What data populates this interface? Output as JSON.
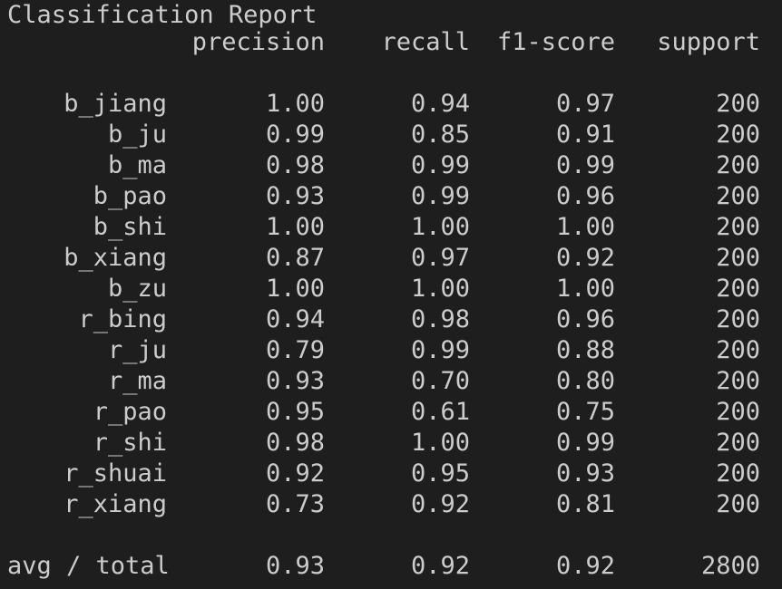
{
  "report": {
    "title": "Classification Report",
    "headers": {
      "precision": "precision",
      "recall": "recall",
      "f1": "f1-score",
      "support": "support"
    },
    "rows": [
      {
        "label": "b_jiang",
        "precision": "1.00",
        "recall": "0.94",
        "f1": "0.97",
        "support": "200"
      },
      {
        "label": "b_ju",
        "precision": "0.99",
        "recall": "0.85",
        "f1": "0.91",
        "support": "200"
      },
      {
        "label": "b_ma",
        "precision": "0.98",
        "recall": "0.99",
        "f1": "0.99",
        "support": "200"
      },
      {
        "label": "b_pao",
        "precision": "0.93",
        "recall": "0.99",
        "f1": "0.96",
        "support": "200"
      },
      {
        "label": "b_shi",
        "precision": "1.00",
        "recall": "1.00",
        "f1": "1.00",
        "support": "200"
      },
      {
        "label": "b_xiang",
        "precision": "0.87",
        "recall": "0.97",
        "f1": "0.92",
        "support": "200"
      },
      {
        "label": "b_zu",
        "precision": "1.00",
        "recall": "1.00",
        "f1": "1.00",
        "support": "200"
      },
      {
        "label": "r_bing",
        "precision": "0.94",
        "recall": "0.98",
        "f1": "0.96",
        "support": "200"
      },
      {
        "label": "r_ju",
        "precision": "0.79",
        "recall": "0.99",
        "f1": "0.88",
        "support": "200"
      },
      {
        "label": "r_ma",
        "precision": "0.93",
        "recall": "0.70",
        "f1": "0.80",
        "support": "200"
      },
      {
        "label": "r_pao",
        "precision": "0.95",
        "recall": "0.61",
        "f1": "0.75",
        "support": "200"
      },
      {
        "label": "r_shi",
        "precision": "0.98",
        "recall": "1.00",
        "f1": "0.99",
        "support": "200"
      },
      {
        "label": "r_shuai",
        "precision": "0.92",
        "recall": "0.95",
        "f1": "0.93",
        "support": "200"
      },
      {
        "label": "r_xiang",
        "precision": "0.73",
        "recall": "0.92",
        "f1": "0.81",
        "support": "200"
      }
    ],
    "total": {
      "label": "avg / total",
      "precision": "0.93",
      "recall": "0.92",
      "f1": "0.92",
      "support": "2800"
    }
  },
  "colors": {
    "background": "#1e1e1e",
    "text": "#cccccc"
  }
}
